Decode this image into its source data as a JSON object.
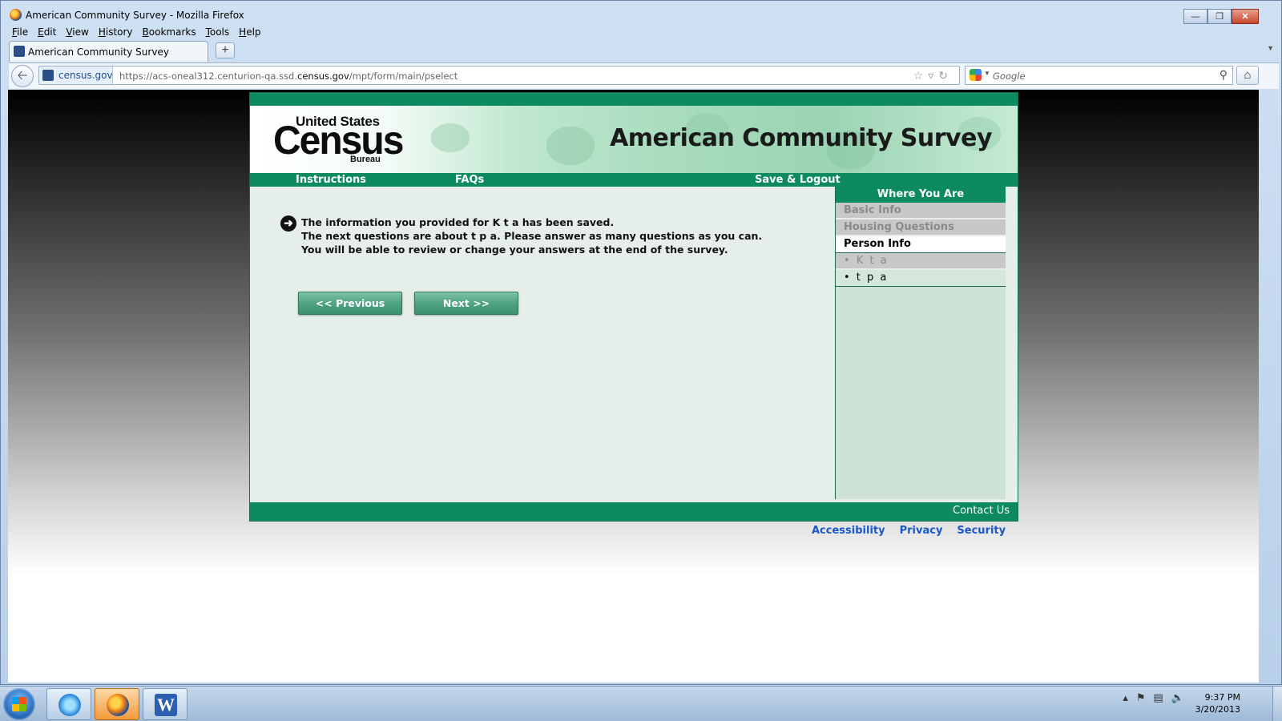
{
  "window": {
    "title": "American Community Survey - Mozilla Firefox"
  },
  "menu": [
    "File",
    "Edit",
    "View",
    "History",
    "Bookmarks",
    "Tools",
    "Help"
  ],
  "tab": {
    "label": "American Community Survey"
  },
  "address": {
    "site": "census.gov",
    "url_prefix": "https://acs-oneal312.centurion-qa.ssd.",
    "url_domain": "census.gov",
    "url_suffix": "/mpt/form/main/pselect"
  },
  "search": {
    "placeholder": "Google"
  },
  "banner": {
    "logo_top": "United States",
    "logo_main": "Census",
    "logo_bottom": "Bureau",
    "title": "American Community Survey"
  },
  "nav": {
    "instructions": "Instructions",
    "faqs": "FAQs",
    "save_logout": "Save & Logout"
  },
  "message": {
    "line1": "The information you provided for K t a has been saved.",
    "line2": "The next questions are about t p a. Please answer as many questions as you can.",
    "line3": "You will be able to review or change your answers at the end of the survey."
  },
  "buttons": {
    "previous": "<<   Previous",
    "next": "Next   >>"
  },
  "sidebar": {
    "heading": "Where You Are",
    "items": [
      {
        "label": "Basic Info",
        "state": "done"
      },
      {
        "label": "Housing Questions",
        "state": "done"
      },
      {
        "label": "Person Info",
        "state": "current"
      },
      {
        "label": "• K t a",
        "state": "done"
      },
      {
        "label": "• t p a",
        "state": "todo"
      }
    ]
  },
  "footer": {
    "contact": "Contact Us",
    "links": [
      "Accessibility",
      "Privacy",
      "Security"
    ]
  },
  "taskbar": {
    "time": "9:37 PM",
    "date": "3/20/2013"
  }
}
